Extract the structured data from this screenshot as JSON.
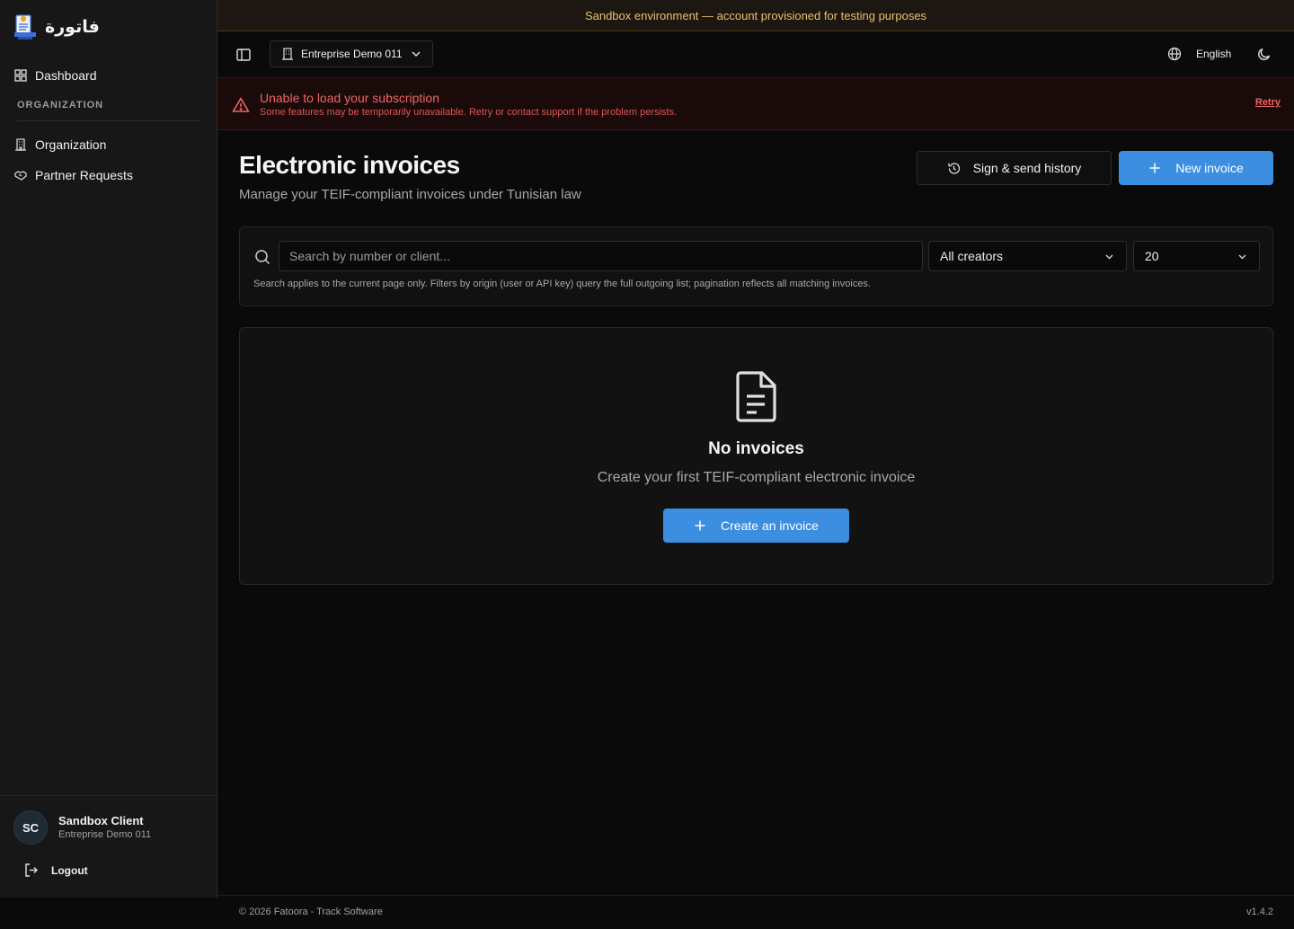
{
  "app": {
    "brand_name": "فاتورة",
    "sandbox_banner": "Sandbox environment — account provisioned for testing purposes"
  },
  "sidebar": {
    "dashboard": "Dashboard",
    "section_label": "ORGANIZATION",
    "organization": "Organization",
    "partner_requests": "Partner Requests"
  },
  "user": {
    "initials": "SC",
    "name": "Sandbox Client",
    "org": "Entreprise Demo 011",
    "logout": "Logout"
  },
  "topbar": {
    "org_selector": "Entreprise Demo 011",
    "language": "English"
  },
  "error": {
    "title": "Unable to load your subscription",
    "message": "Some features may be temporarily unavailable. Retry or contact support if the problem persists.",
    "retry": "Retry"
  },
  "page": {
    "title": "Electronic invoices",
    "subtitle": "Manage your TEIF-compliant invoices under Tunisian law",
    "history_button": "Sign & send history",
    "new_button": "New invoice"
  },
  "filters": {
    "search_placeholder": "Search by number or client...",
    "search_value": "",
    "creator_select": "All creators",
    "page_size": "20",
    "hint": "Search applies to the current page only. Filters by origin (user or API key) query the full outgoing list; pagination reflects all matching invoices."
  },
  "empty_state": {
    "icon": "file-text-icon",
    "title": "No invoices",
    "text": "Create your first TEIF-compliant electronic invoice",
    "button": "Create an invoice"
  },
  "footer": {
    "copyright": "© 2026 Fatoora - Track Software",
    "version": "v1.4.2"
  },
  "colors": {
    "accent": "#3b8ee0",
    "error": "#f06565",
    "warning": "#e8c070"
  }
}
